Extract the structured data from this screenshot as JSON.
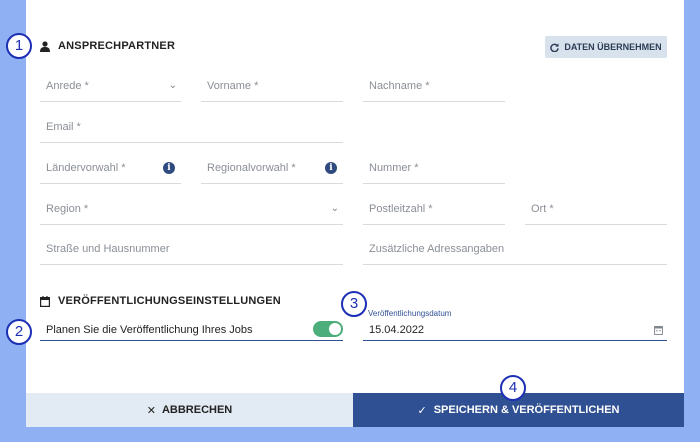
{
  "contact": {
    "title": "ANSPRECHPARTNER",
    "takeover_label": "DATEN ÜBERNEHMEN",
    "anrede": "Anrede *",
    "vorname": "Vorname *",
    "nachname": "Nachname *",
    "email": "Email *",
    "laendervorwahl": "Ländervorwahl *",
    "regionalvorwahl": "Regionalvorwahl *",
    "nummer": "Nummer *",
    "region": "Region *",
    "plz": "Postleitzahl *",
    "ort": "Ort *",
    "strasse": "Straße und Hausnummer",
    "zusatz": "Zusätzliche Adressangaben"
  },
  "publishing": {
    "title": "VERÖFFENTLICHUNGSEINSTELLUNGEN",
    "schedule_label": "Planen Sie die Veröffentlichung Ihres Jobs",
    "schedule_enabled": true,
    "date_label": "Veröffentlichungsdatum",
    "date_value": "15.04.2022"
  },
  "footer": {
    "cancel_label": "ABBRECHEN",
    "save_label": "SPEICHERN & VERÖFFENTLICHEN"
  },
  "annotations": [
    "1",
    "2",
    "3",
    "4"
  ],
  "colors": {
    "background": "#8fb0f2",
    "primary": "#2f5092",
    "toggle_on": "#4cae7a",
    "annotation": "#1c2fb5",
    "date_label": "#2f5092"
  },
  "icons": {
    "person": "person-icon",
    "refresh": "refresh-icon",
    "chevron": "chevron-down-icon",
    "info": "info-icon",
    "calendar": "calendar-icon",
    "close": "close-icon",
    "check": "check-icon"
  }
}
